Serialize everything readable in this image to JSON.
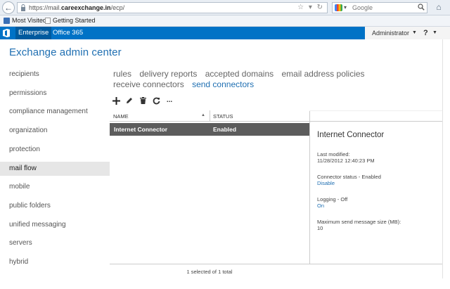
{
  "browser": {
    "url_prefix": "https://mail.",
    "url_domain": "careexchange.in",
    "url_suffix": "/ecp/",
    "search_placeholder": "Google",
    "bookmarks": [
      {
        "label": "Most Visited"
      },
      {
        "label": "Getting Started"
      }
    ]
  },
  "office_bar": {
    "tabs": [
      {
        "label": "Enterprise"
      },
      {
        "label": "Office 365"
      }
    ],
    "user": "Administrator",
    "help_label": "?"
  },
  "page": {
    "title": "Exchange admin center"
  },
  "left_nav": {
    "items": [
      {
        "label": "recipients"
      },
      {
        "label": "permissions"
      },
      {
        "label": "compliance management"
      },
      {
        "label": "organization"
      },
      {
        "label": "protection"
      },
      {
        "label": "mail flow"
      },
      {
        "label": "mobile"
      },
      {
        "label": "public folders"
      },
      {
        "label": "unified messaging"
      },
      {
        "label": "servers"
      },
      {
        "label": "hybrid"
      }
    ],
    "selected": "mail flow"
  },
  "sub_tabs": {
    "items": [
      {
        "label": "rules"
      },
      {
        "label": "delivery reports"
      },
      {
        "label": "accepted domains"
      },
      {
        "label": "email address policies"
      },
      {
        "label": "receive connectors"
      },
      {
        "label": "send connectors"
      }
    ],
    "active": "send connectors"
  },
  "toolbar": {
    "icons": [
      "add-icon",
      "edit-icon",
      "delete-icon",
      "refresh-icon",
      "more-icon"
    ],
    "more_label": "..."
  },
  "grid": {
    "columns": [
      "NAME",
      "STATUS"
    ],
    "sort_indicator": "▲",
    "rows": [
      {
        "name": "Internet Connector",
        "status": "Enabled",
        "selected": true
      }
    ],
    "status_text": "1 selected of 1 total"
  },
  "details": {
    "title": "Internet Connector",
    "last_modified_label": "Last modified:",
    "last_modified_value": "11/28/2012 12:40:23 PM",
    "connector_status_label": "Connector status - Enabled",
    "connector_status_link": "Disable",
    "logging_label": "Logging - Off",
    "logging_link": "On",
    "max_size_label": "Maximum send message size (MB):",
    "max_size_value": "10"
  },
  "colors": {
    "office_blue": "#0072c6",
    "accent_text": "#1f6fb2",
    "selected_row": "#5c5c5c",
    "nav_selected_bg": "#e6e6e6"
  }
}
